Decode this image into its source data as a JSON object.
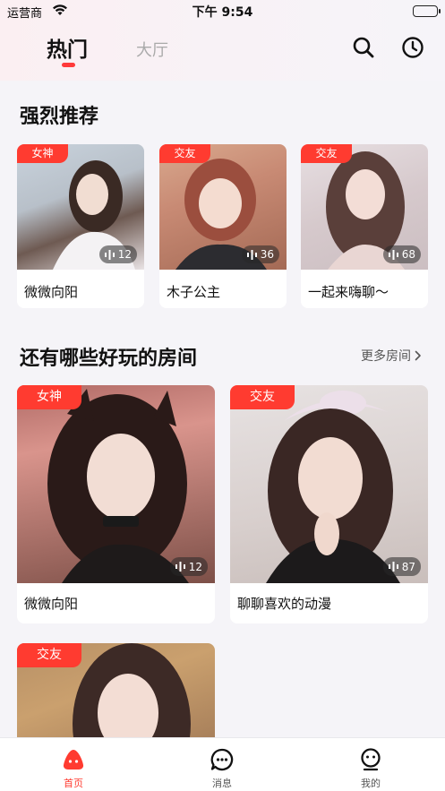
{
  "status_bar": {
    "carrier": "运营商",
    "time": "下午 9:54"
  },
  "header": {
    "tabs": [
      {
        "label": "热门",
        "active": true
      },
      {
        "label": "大厅",
        "active": false
      }
    ]
  },
  "recommended": {
    "title": "强烈推荐",
    "cards": [
      {
        "tag": "女神",
        "viewers": "12",
        "name": "微微向阳"
      },
      {
        "tag": "交友",
        "viewers": "36",
        "name": "木子公主"
      },
      {
        "tag": "交友",
        "viewers": "68",
        "name": "一起来嗨聊～"
      }
    ]
  },
  "rooms": {
    "title": "还有哪些好玩的房间",
    "more_label": "更多房间",
    "cards": [
      {
        "tag": "女神",
        "viewers": "12",
        "name": "微微向阳"
      },
      {
        "tag": "交友",
        "viewers": "87",
        "name": "聊聊喜欢的动漫"
      },
      {
        "tag": "交友",
        "viewers": "",
        "name": ""
      }
    ]
  },
  "bottom_nav": [
    {
      "label": "首页",
      "active": true
    },
    {
      "label": "消息",
      "active": false
    },
    {
      "label": "我的",
      "active": false
    }
  ],
  "colors": {
    "accent": "#ff3b30",
    "underline": "#ff3a3a",
    "inactive_tab": "#aaaaaa"
  }
}
